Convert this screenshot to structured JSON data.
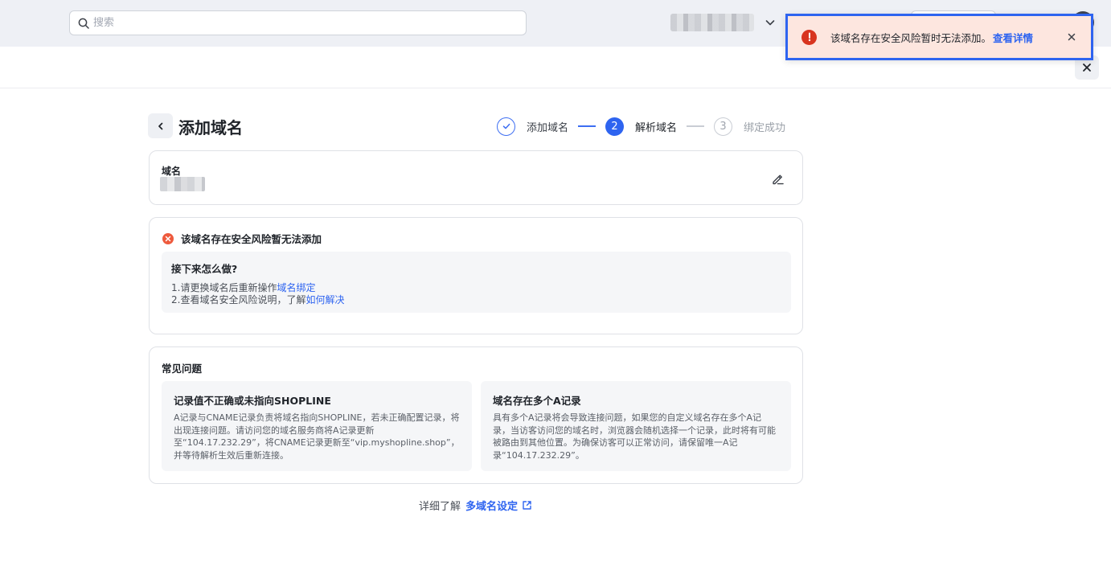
{
  "header": {
    "search": {
      "placeholder": "搜索",
      "icon": "search-icon"
    },
    "store_selector": {
      "icon": "chevron-down-icon"
    }
  },
  "toast": {
    "message": "该域名存在安全风险暂时无法添加。",
    "link": "查看详情",
    "icon": "error-icon",
    "close_icon": "close-icon"
  },
  "modal": {
    "close_icon": "close-icon"
  },
  "page": {
    "title": "添加域名",
    "back_icon": "chevron-left-icon"
  },
  "steps": [
    {
      "number": "1",
      "label": "添加域名",
      "status": "done"
    },
    {
      "number": "2",
      "label": "解析域名",
      "status": "active"
    },
    {
      "number": "3",
      "label": "绑定成功",
      "status": "pending"
    }
  ],
  "domain_card": {
    "label": "域名",
    "edit_icon": "edit-icon"
  },
  "error_card": {
    "title": "该域名存在安全风险暂无法添加",
    "next_steps": {
      "title": "接下来怎么做?",
      "line1_text": "1.请更换域名后重新操作",
      "line1_link": "域名绑定",
      "line2_text": "2.查看域名安全风险说明，了解",
      "line2_link": "如何解决"
    }
  },
  "faq": {
    "heading": "常见问题",
    "items": [
      {
        "title": "记录值不正确或未指向SHOPLINE",
        "body": "A记录与CNAME记录负责将域名指向SHOPLINE，若未正确配置记录，将出现连接问题。请访问您的域名服务商将A记录更新至“104.17.232.29”，将CNAME记录更新至“vip.myshopline.shop”，并等待解析生效后重新连接。"
      },
      {
        "title": "域名存在多个A记录",
        "body": "具有多个A记录将会导致连接问题，如果您的自定义域名存在多个A记录，当访客访问您的域名时，浏览器会随机选择一个记录，此时将有可能被路由到其他位置。为确保访客可以正常访问，请保留唯一A记录“104.17.232.29”。"
      }
    ]
  },
  "footer": {
    "text": "详细了解",
    "link": "多域名设定",
    "icon": "external-link-icon"
  },
  "colors": {
    "primary": "#2e64f0",
    "error": "#d8341f",
    "toast_bg": "#fde6df"
  }
}
